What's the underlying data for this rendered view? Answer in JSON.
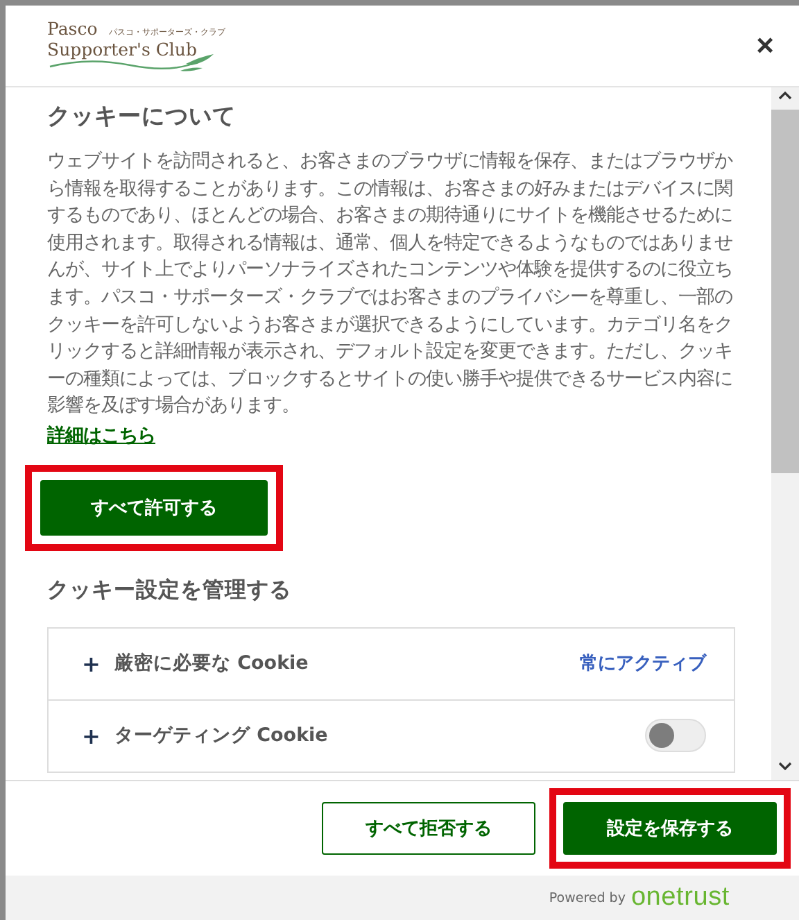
{
  "logo": {
    "name": "Pasco",
    "name_line2": "Supporter's Club",
    "tagline": "パスコ・サポーターズ・クラブ"
  },
  "close": "×",
  "about": {
    "title": "クッキーについて",
    "body": "ウェブサイトを訪問されると、お客さまのブラウザに情報を保存、またはブラウザから情報を取得することがあります。この情報は、お客さまの好みまたはデバイスに関するものであり、ほとんどの場合、お客さまの期待通りにサイトを機能させるために使用されます。取得される情報は、通常、個人を特定できるようなものではありませんが、サイト上でよりパーソナライズされたコンテンツや体験を提供するのに役立ちます。パスコ・サポーターズ・クラブではお客さまのプライバシーを尊重し、一部のクッキーを許可しないようお客さまが選択できるようにしています。カテゴリ名をクリックすると詳細情報が表示され、デフォルト設定を変更できます。ただし、クッキーの種類によっては、ブロックするとサイトの使い勝手や提供できるサービス内容に影響を及ぼす場合があります。",
    "link": "詳細はこちら"
  },
  "allow_all": {
    "label": "すべて許可する",
    "highlighted": true
  },
  "manage": {
    "title": "クッキー設定を管理する",
    "categories": [
      {
        "kind": "always",
        "expand": "+",
        "name": "厳密に必要な Cookie",
        "status": "常にアクティブ"
      },
      {
        "kind": "toggle",
        "expand": "+",
        "name": "ターゲティング Cookie",
        "on": false
      }
    ]
  },
  "footer": {
    "buttons": [
      {
        "kind": "outline",
        "label": "すべて拒否する",
        "highlighted": false
      },
      {
        "kind": "filled",
        "label": "設定を保存する",
        "highlighted": true
      }
    ],
    "powered_by": "Powered by",
    "brand": "onetrust"
  }
}
